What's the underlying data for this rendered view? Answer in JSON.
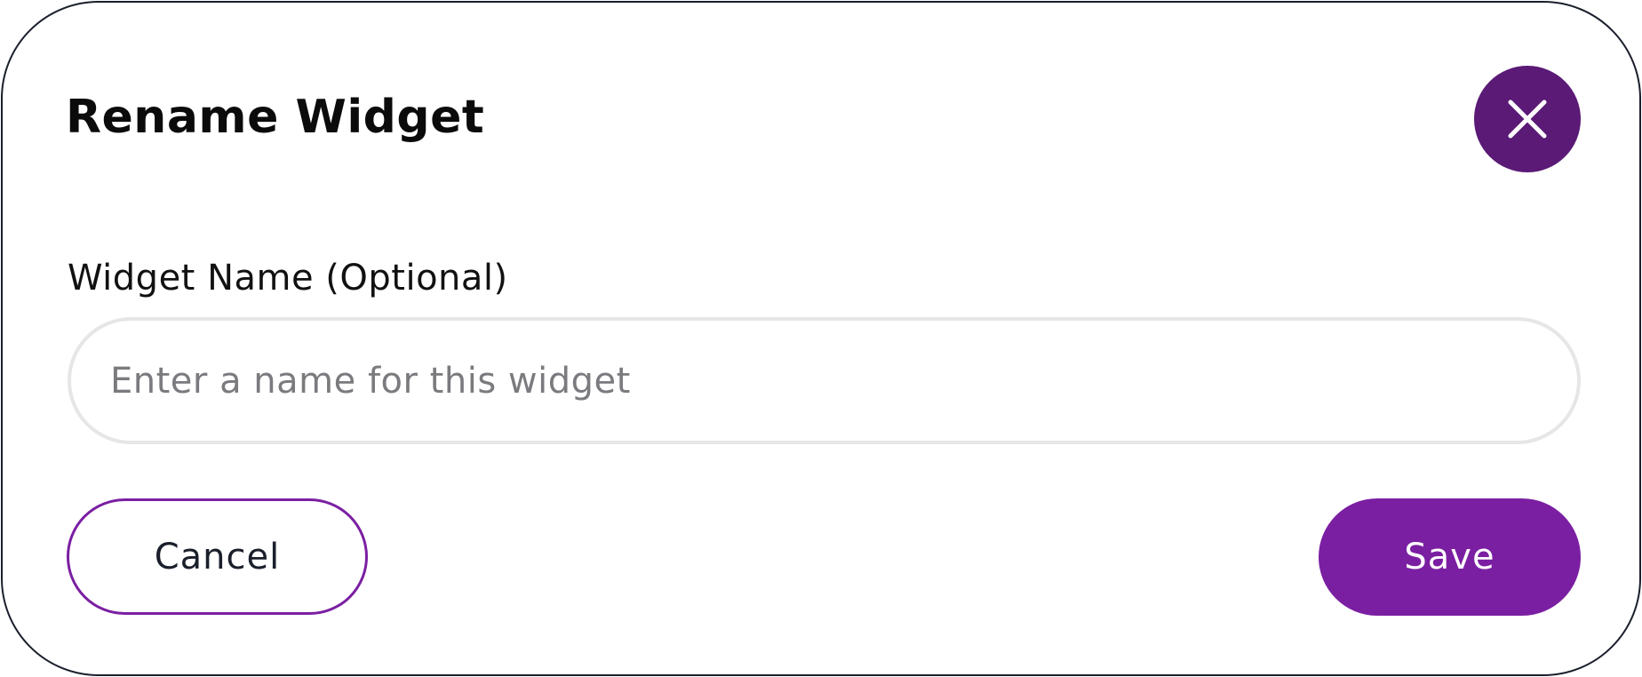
{
  "dialog": {
    "title": "Rename Widget",
    "close_icon": "close-icon",
    "field": {
      "label": "Widget Name (Optional)",
      "value": "",
      "placeholder": "Enter a name for this widget"
    },
    "actions": {
      "cancel_label": "Cancel",
      "save_label": "Save"
    }
  },
  "colors": {
    "accent": "#7b1fa2",
    "close_button": "#5a1a76",
    "border": "#1a1f2b",
    "input_border": "#e6e6e6",
    "placeholder": "#7b7b7f"
  }
}
